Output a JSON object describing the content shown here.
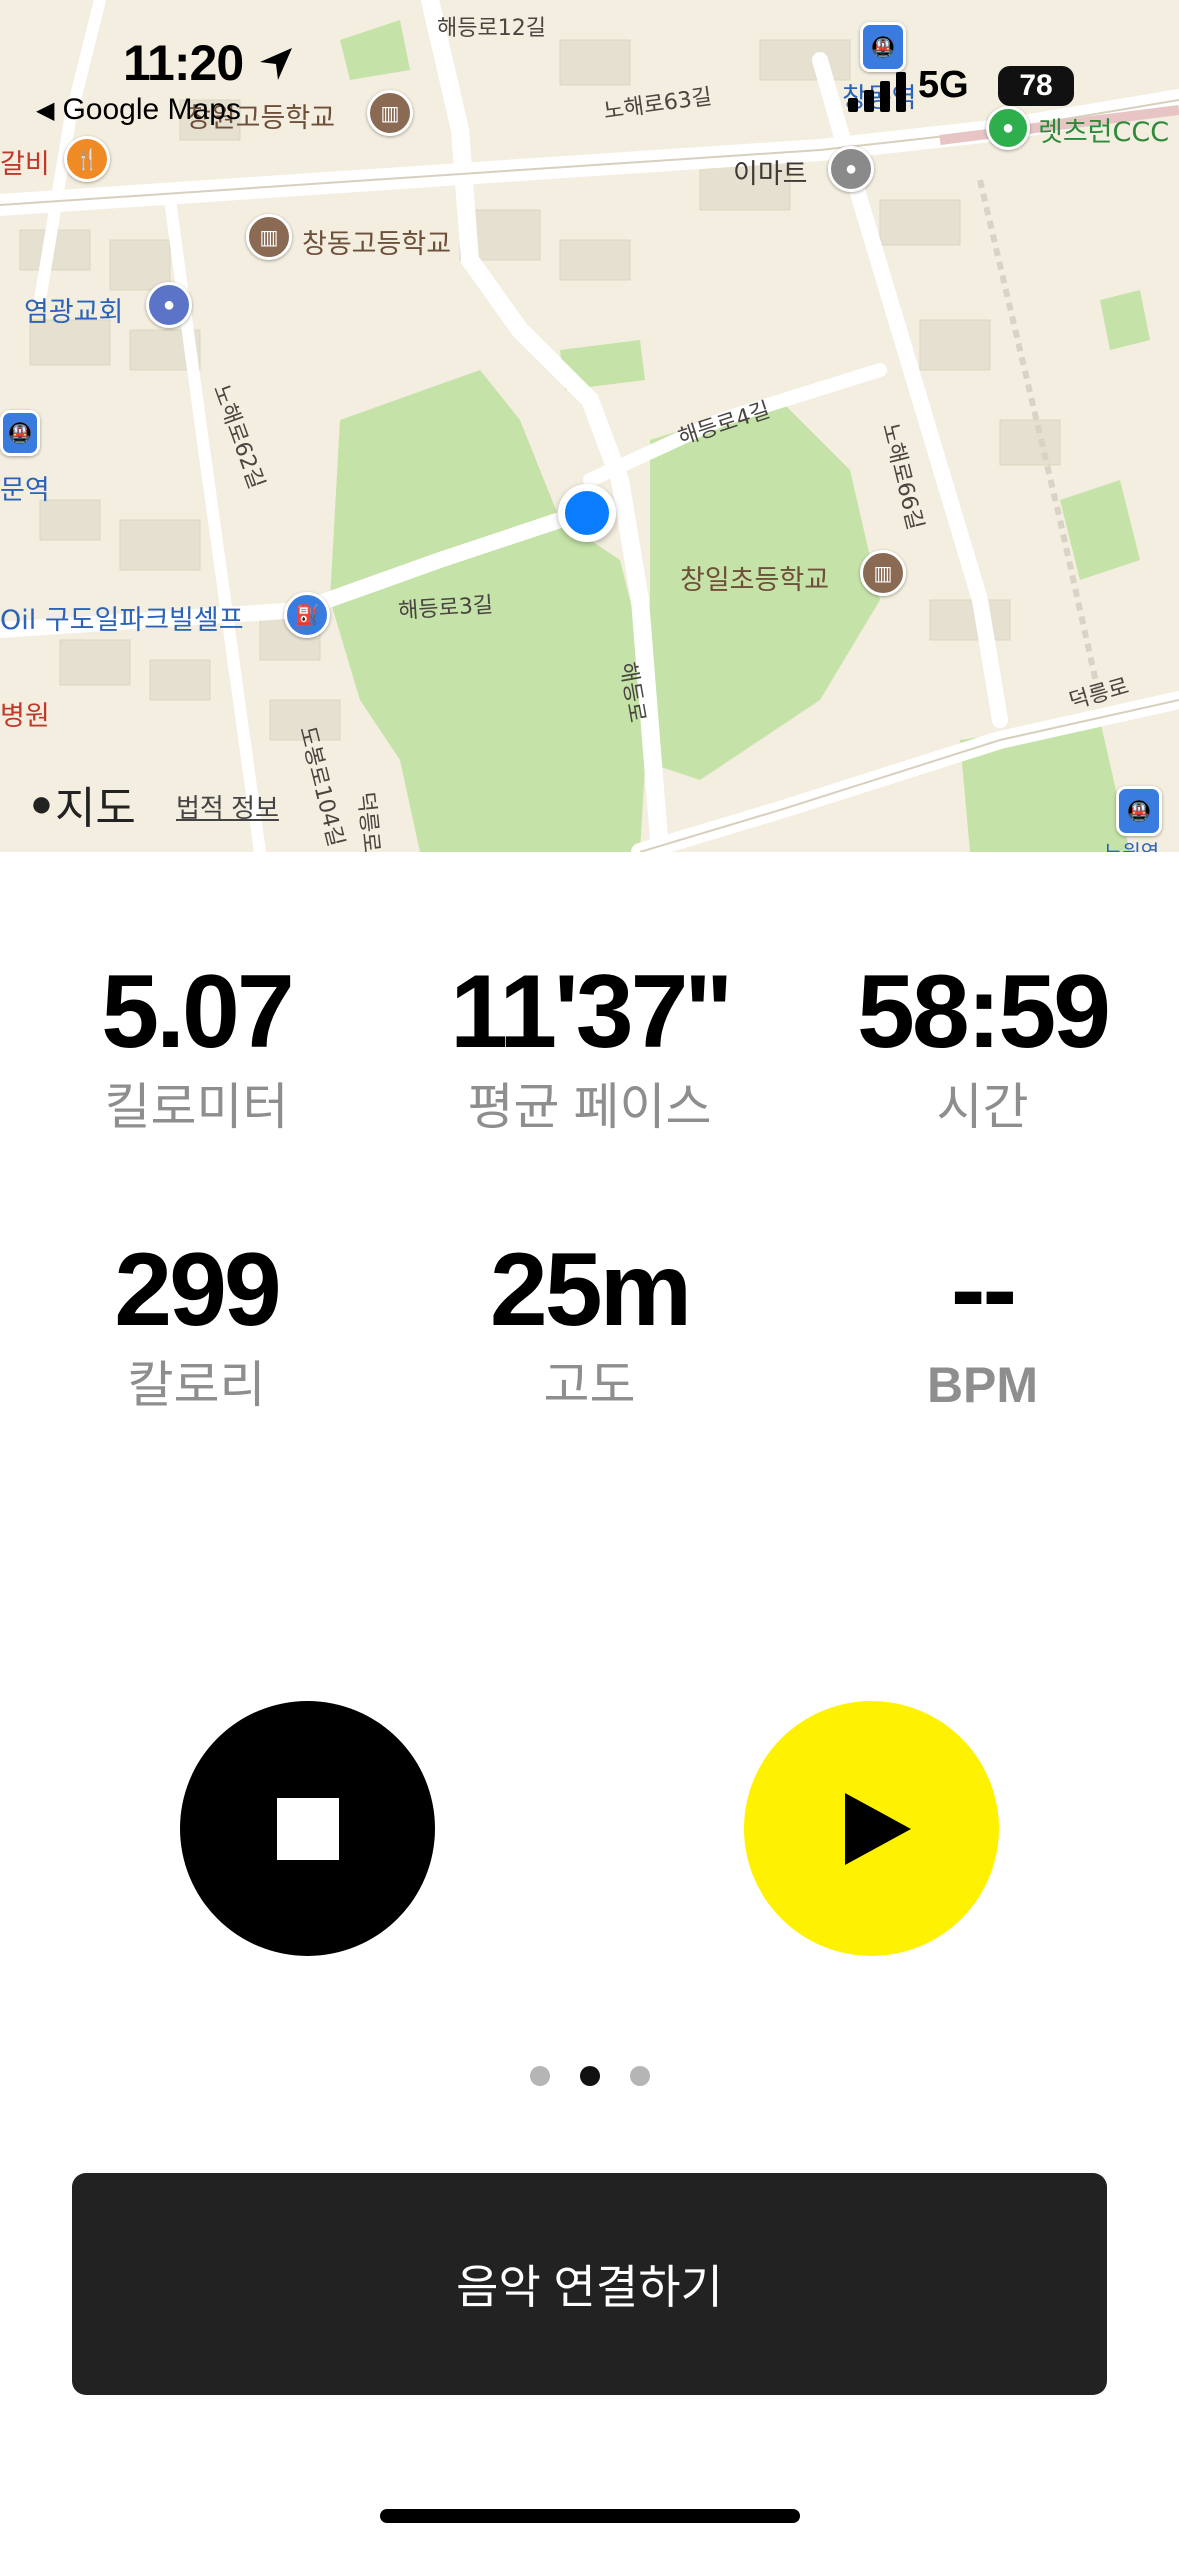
{
  "status_bar": {
    "time": "11:20",
    "back_app": "Google Maps",
    "network": "5G",
    "battery": "78"
  },
  "map": {
    "labels": {
      "road_12": "해등로12길",
      "road_63": "노해로63길",
      "emart": "이마트",
      "school_top": "창원고등학교",
      "galbi": "갈비",
      "changdong_high": "창동고등학교",
      "church": "염광교회",
      "road_62": "노해로62길",
      "road_4": "해등로4길",
      "road_66": "노해로66길",
      "station_left": "문역",
      "changil": "창일초등학교",
      "oil": "Oil 구도일파크빌셀프",
      "road_3": "해등로3길",
      "haedeung": "해등로",
      "deokreung": "덕릉로",
      "hospital": "병원",
      "dobong104": "도봉로104길",
      "dobong_bottom": "덕릉로",
      "lets_run": "렛츠런CCC",
      "station_top": "창동역",
      "station_bottom": "노원역"
    },
    "attribution": "지도",
    "legal": "법적 정보"
  },
  "stats": {
    "distance": {
      "value": "5.07",
      "label": "킬로미터"
    },
    "pace": {
      "value": "11'37''",
      "label": "평균 페이스"
    },
    "time": {
      "value": "58:59",
      "label": "시간"
    },
    "calories": {
      "value": "299",
      "label": "칼로리"
    },
    "altitude": {
      "value": "25m",
      "label": "고도"
    },
    "heart_rate": {
      "value": "--",
      "label": "BPM"
    }
  },
  "controls": {
    "stop_icon": "stop-icon",
    "play_icon": "play-icon",
    "colors": {
      "stop_bg": "#000000",
      "play_bg": "#fff200"
    }
  },
  "pager": {
    "count": 3,
    "active": 1
  },
  "music_button": {
    "label": "음악 연결하기"
  }
}
